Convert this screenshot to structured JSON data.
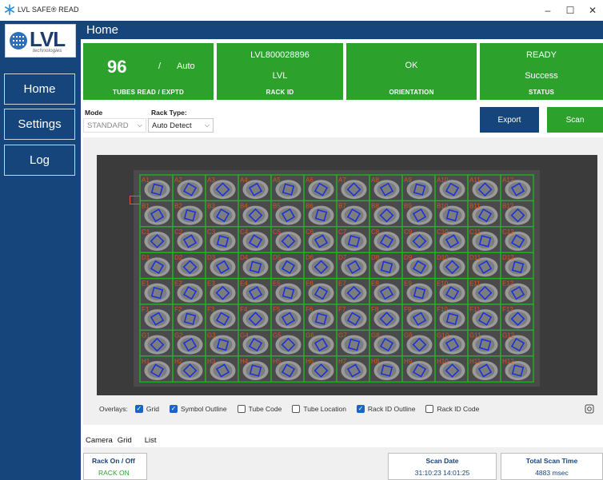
{
  "window": {
    "title": "LVL SAFE® READ",
    "controls": {
      "minimize": "–",
      "maximize": "☐",
      "close": "✕"
    }
  },
  "logo": {
    "text": "LVL",
    "subtitle": "technologies"
  },
  "sidebar": {
    "items": [
      {
        "label": "Home"
      },
      {
        "label": "Settings"
      },
      {
        "label": "Log"
      }
    ]
  },
  "header": {
    "title": "Home"
  },
  "tiles": {
    "tubes": {
      "value": "96",
      "slash": "/",
      "expected": "Auto",
      "label": "TUBES READ / EXPTD"
    },
    "rack": {
      "line1": "LVL800028896",
      "line2": "LVL",
      "label": "RACK ID"
    },
    "orientation": {
      "value": "OK",
      "label": "ORIENTATION"
    },
    "status": {
      "line1": "READY",
      "line2": "Success",
      "label": "STATUS"
    }
  },
  "controls": {
    "mode_label": "Mode",
    "mode_value": "STANDARD",
    "rack_type_label": "Rack Type:",
    "rack_type_value": "Auto Detect",
    "export_label": "Export",
    "scan_label": "Scan"
  },
  "rack_grid": {
    "rows": [
      "A",
      "B",
      "C",
      "D",
      "E",
      "F",
      "G",
      "H"
    ],
    "cols": 12
  },
  "overlays": {
    "label": "Overlays:",
    "items": [
      {
        "label": "Grid",
        "checked": true
      },
      {
        "label": "Symbol Outline",
        "checked": true
      },
      {
        "label": "Tube Code",
        "checked": false
      },
      {
        "label": "Tube Location",
        "checked": false
      },
      {
        "label": "Rack ID Outline",
        "checked": true
      },
      {
        "label": "Rack ID Code",
        "checked": false
      }
    ]
  },
  "tabs": [
    {
      "label": "Camera",
      "active": true
    },
    {
      "label": "Grid",
      "active": false
    },
    {
      "label": "List",
      "active": false
    }
  ],
  "footer": {
    "rack_onoff_title": "Rack On / Off",
    "rack_onoff_value": "RACK ON",
    "scan_date_title": "Scan Date",
    "scan_date_value": "31:10:23 14:01:25",
    "scan_time_title": "Total Scan Time",
    "scan_time_value": "4883 msec"
  },
  "colors": {
    "navy": "#16457c",
    "green": "#2ca12c",
    "grid_green": "#1fb51f",
    "symbol_blue": "#1a33d6",
    "well_label_red": "#d9531e"
  }
}
